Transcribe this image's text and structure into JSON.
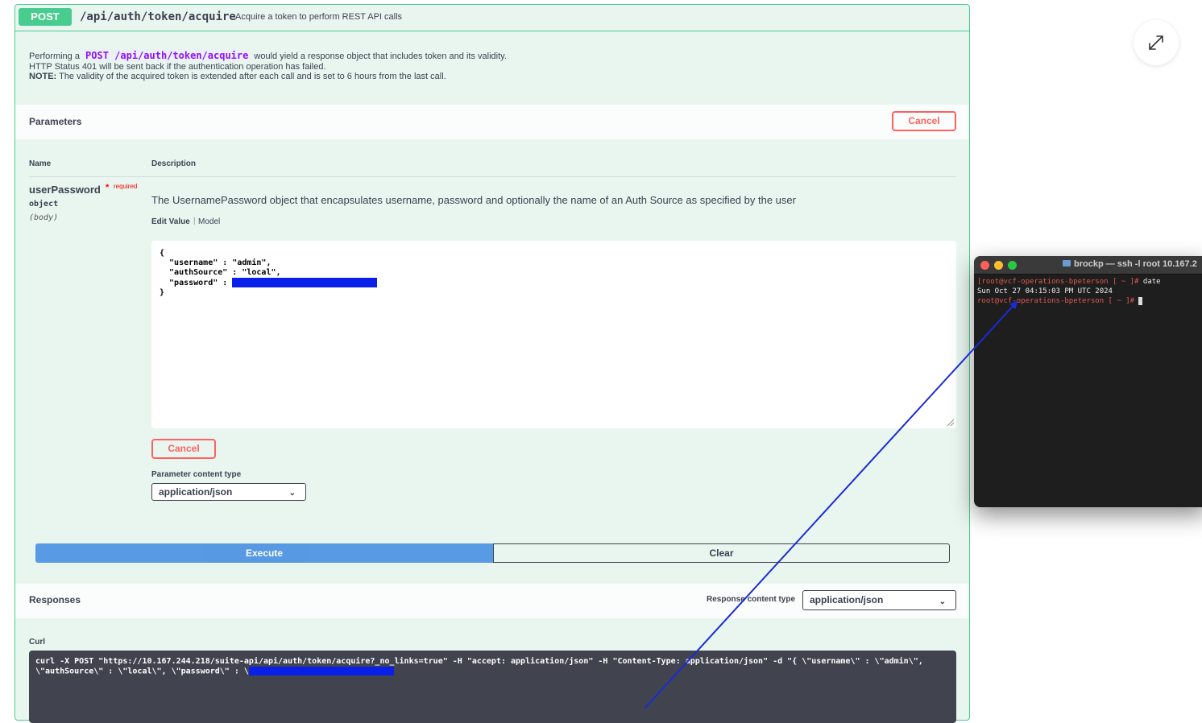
{
  "operation": {
    "method": "POST",
    "path": "/api/auth/token/acquire",
    "summary": "Acquire a token to perform REST API calls",
    "description": {
      "line1_prefix": "Performing a",
      "line1_code": "POST /api/auth/token/acquire",
      "line1_suffix": "would yield a response object that includes token and its validity.",
      "line2": "HTTP Status 401 will be sent back if the authentication operation has failed.",
      "note_label": "NOTE:",
      "note_text": "The validity of the acquired token is extended after each call and is set to 6 hours from the last call."
    }
  },
  "parameters": {
    "title": "Parameters",
    "cancel_label": "Cancel",
    "col_name": "Name",
    "col_description": "Description",
    "param": {
      "name": "userPassword",
      "required_star": "*",
      "required": "required",
      "type": "object",
      "in": "(body)",
      "description": "The UsernamePassword object that encapsulates username, password and optionally the name of an Auth Source as specified by the user",
      "tab_edit_value": "Edit Value",
      "tab_separator": "|",
      "tab_model": "Model",
      "body_lines": {
        "open": "{",
        "username": "  \"username\" : \"admin\",",
        "authsource": "  \"authSource\" : \"local\",",
        "password_key": "  \"password\" : ",
        "close": "}"
      },
      "content_type_label": "Parameter content type",
      "content_type_value": "application/json"
    }
  },
  "actions": {
    "execute_label": "Execute",
    "clear_label": "Clear"
  },
  "responses": {
    "title": "Responses",
    "content_type_label": "Response content type",
    "content_type_value": "application/json",
    "curl_label": "Curl",
    "curl_line1": "curl -X POST \"https://10.167.244.218/suite-api/api/auth/token/acquire?_no_links=true\" -H \"accept: application/json\" -H \"Content-Type: application/json\" -d \"{ \\\"username\\\" : \\\"admin\\\",",
    "curl_line2": "\\\"authSource\\\" : \\\"local\\\", \\\"password\\\" : \\"
  },
  "terminal": {
    "title": "brockp — ssh -l root 10.167.2",
    "line1_prompt": "[root@vcf-operations-bpeterson [ ~ ]# ",
    "line1_cmd": "date",
    "line2": "Sun Oct 27 04:15:03 PM UTC 2024",
    "line3_prompt": "root@vcf-operations-bpeterson [ ~ ]# "
  },
  "icons": {
    "expand": "expand-arrows-icon",
    "chevron": "chevron-down-icon"
  },
  "colors": {
    "post_green": "#49cc90",
    "execute_blue": "#4990e2",
    "cancel_red": "#ff6060",
    "redaction_blue": "#0a1fe8",
    "arrow_blue": "#1a2bd6"
  }
}
